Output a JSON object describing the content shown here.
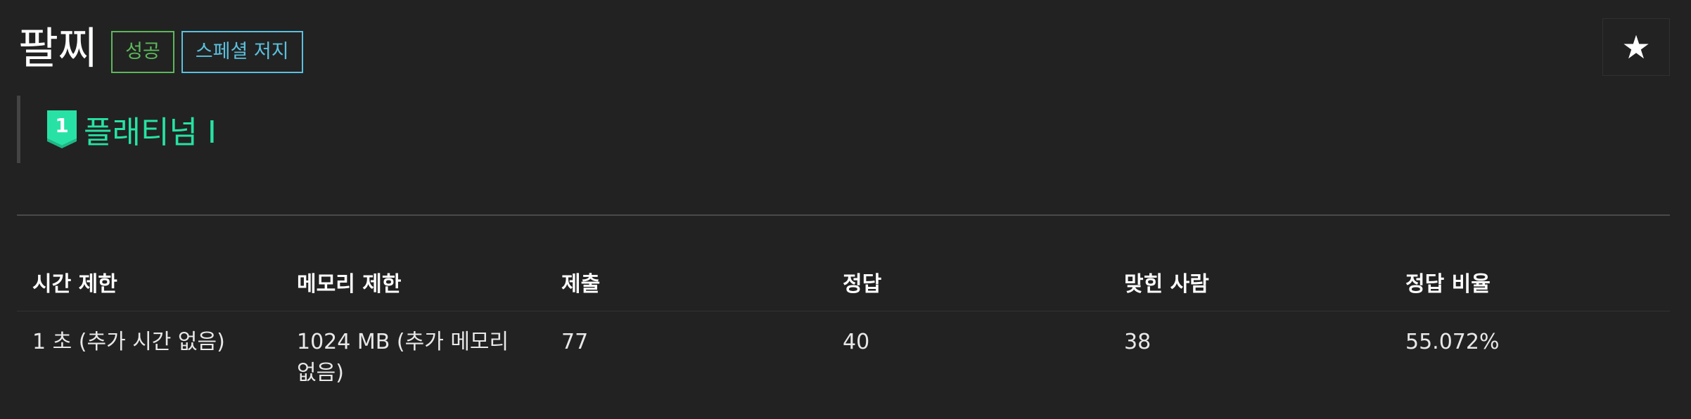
{
  "problem": {
    "title": "팔찌",
    "labels": [
      "성공",
      "스페셜 저지"
    ],
    "star_icon": "★"
  },
  "tier": {
    "level": "1",
    "name": "플래티넘 I",
    "color": "#27e2a4"
  },
  "info_table": {
    "headers": [
      "시간 제한",
      "메모리 제한",
      "제출",
      "정답",
      "맞힌 사람",
      "정답 비율"
    ],
    "values": [
      "1 초 (추가 시간 없음)",
      "1024 MB (추가 메모리 없음)",
      "77",
      "40",
      "38",
      "55.072%"
    ]
  },
  "colors": {
    "background": "#222222",
    "success": "#5cb85c",
    "special_judge": "#5bc0de",
    "tier": "#27e2a4"
  }
}
